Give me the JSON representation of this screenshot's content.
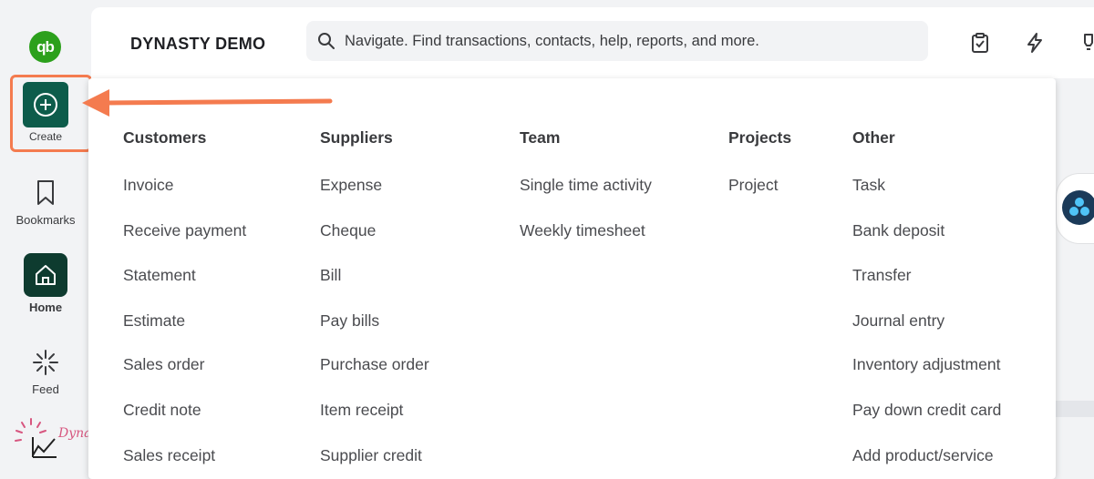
{
  "sidebar": {
    "logo": "qb",
    "items": [
      {
        "label": "Create",
        "icon": "plus-circle-icon"
      },
      {
        "label": "Bookmarks",
        "icon": "bookmark-icon"
      },
      {
        "label": "Home",
        "icon": "home-icon"
      },
      {
        "label": "Feed",
        "icon": "feed-sparkle-icon"
      }
    ],
    "brand_watermark": "Dynasty"
  },
  "header": {
    "company_name": "DYNASTY DEMO",
    "search_placeholder": "Navigate. Find transactions, contacts, help, reports, and more.",
    "icons": [
      "clipboard-check-icon",
      "lightning-icon",
      "lightbulb-icon"
    ]
  },
  "create_menu": {
    "columns": [
      {
        "heading": "Customers",
        "items": [
          "Invoice",
          "Receive payment",
          "Statement",
          "Estimate",
          "Sales order",
          "Credit note",
          "Sales receipt"
        ]
      },
      {
        "heading": "Suppliers",
        "items": [
          "Expense",
          "Cheque",
          "Bill",
          "Pay bills",
          "Purchase order",
          "Item receipt",
          "Supplier credit"
        ]
      },
      {
        "heading": "Team",
        "items": [
          "Single time activity",
          "Weekly timesheet"
        ]
      },
      {
        "heading": "Projects",
        "items": [
          "Project"
        ]
      },
      {
        "heading": "Other",
        "items": [
          "Task",
          "Bank deposit",
          "Transfer",
          "Journal entry",
          "Inventory adjustment",
          "Pay down credit card",
          "Add product/service"
        ]
      }
    ]
  },
  "colors": {
    "accent_green": "#2ca01c",
    "create_button": "#0d5c4b",
    "home_button": "#0e3b2f",
    "highlight_orange": "#f47b4f"
  }
}
